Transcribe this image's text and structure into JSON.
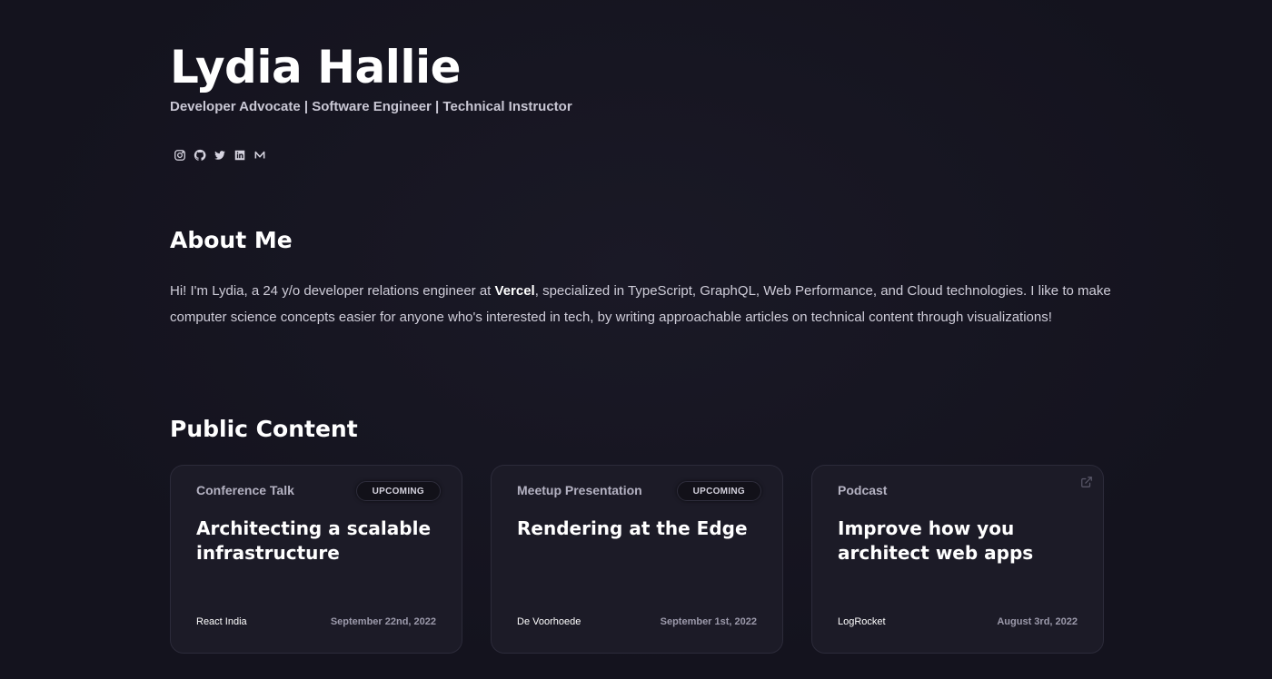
{
  "profile": {
    "name": "Lydia Hallie",
    "tagline": "Developer Advocate | Software Engineer | Technical Instructor",
    "socials": [
      {
        "icon": "instagram-icon"
      },
      {
        "icon": "github-icon"
      },
      {
        "icon": "twitter-icon"
      },
      {
        "icon": "linkedin-icon"
      },
      {
        "icon": "medium-icon"
      }
    ]
  },
  "about": {
    "heading": "About Me",
    "text_before": "Hi! I'm Lydia, a 24 y/o developer relations engineer at ",
    "company": "Vercel",
    "text_after": ", specialized in TypeScript, GraphQL, Web Performance, and Cloud technologies. I like to make computer science concepts easier for anyone who's interested in tech, by writing approachable articles on technical content through visualizations!"
  },
  "public_content": {
    "heading": "Public Content",
    "cards": [
      {
        "type": "Conference Talk",
        "badge": "UPCOMING",
        "title": "Architecting a scalable infrastructure",
        "org": "React India",
        "date": "September 22nd, 2022"
      },
      {
        "type": "Meetup Presentation",
        "badge": "UPCOMING",
        "title": "Rendering at the Edge",
        "org": "De Voorhoede",
        "date": "September 1st, 2022"
      },
      {
        "type": "Podcast",
        "badge": "",
        "external_icon": "external-link-icon",
        "title": "Improve how you architect web apps",
        "org": "LogRocket",
        "date": "August 3rd, 2022"
      }
    ]
  },
  "colors": {
    "background": "#14131e",
    "card_background": "#1c1b27",
    "text_primary": "#ffffff",
    "text_muted": "#9c9aab"
  }
}
